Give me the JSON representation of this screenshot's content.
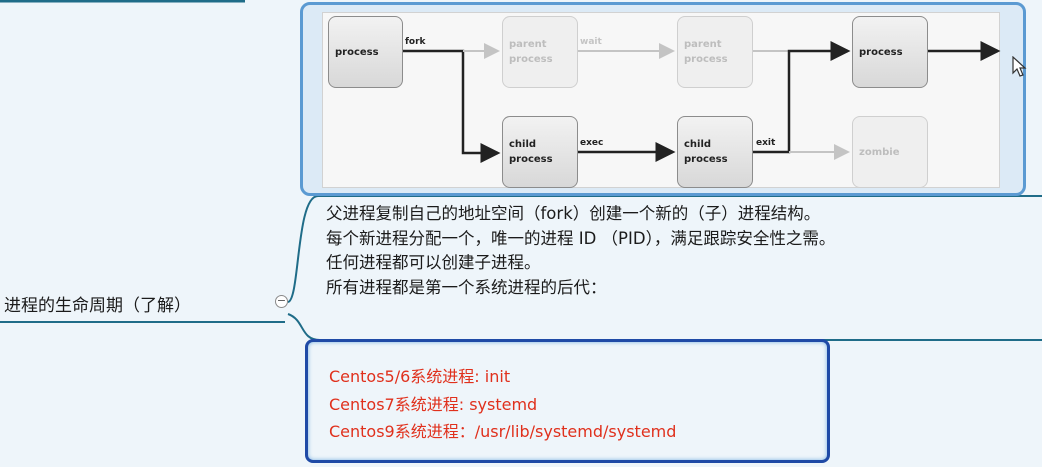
{
  "colors": {
    "frame_border": "#5b9ad2",
    "connector": "#1f6c88",
    "init_text": "#e0301c",
    "init_border": "#1f4aa6"
  },
  "diagram": {
    "boxes": {
      "process_start": "process",
      "parent_process_1": "parent\nprocess",
      "parent_process_2": "parent\nprocess",
      "process_end": "process",
      "child_process_1": "child\nprocess",
      "child_process_2": "child\nprocess",
      "zombie": "zombie"
    },
    "labels": {
      "fork": "fork",
      "wait": "wait",
      "exec": "exec",
      "exit": "exit"
    }
  },
  "topic": {
    "title": "进程的生命周期（了解）",
    "collapse_symbol": "−"
  },
  "description": {
    "lines": [
      "父进程复制自己的地址空间（fork）创建一个新的（子）进程结构。",
      "每个新进程分配一个，唯一的进程 ID （PID），满足跟踪安全性之需。",
      "任何进程都可以创建子进程。",
      "所有进程都是第一个系统进程的后代："
    ]
  },
  "init_systems": {
    "lines": [
      "Centos5/6系统进程: init",
      "Centos7系统进程: systemd",
      "Centos9系统进程：/usr/lib/systemd/systemd"
    ]
  },
  "icons": [
    "collapse-icon",
    "mouse-cursor-icon"
  ]
}
